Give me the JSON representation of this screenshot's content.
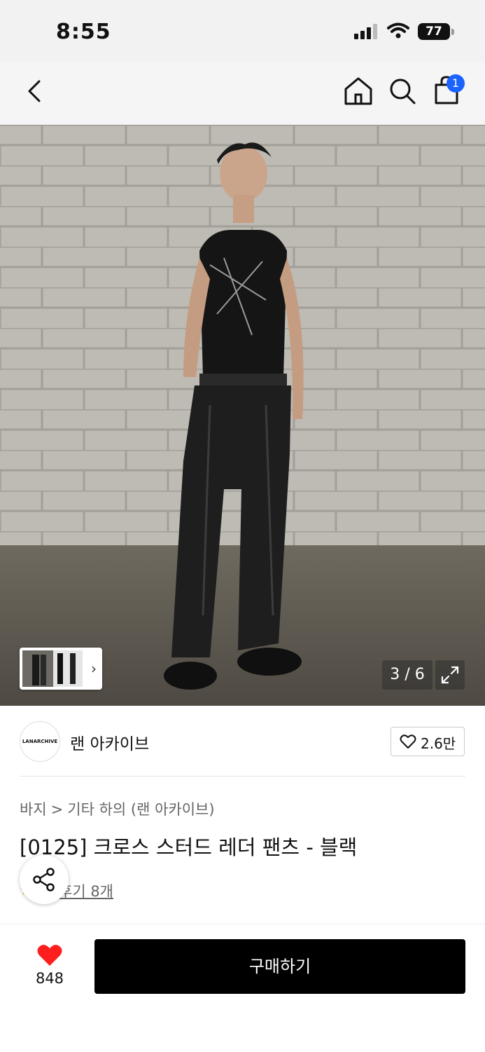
{
  "status_bar": {
    "time": "8:55",
    "battery": "77"
  },
  "nav": {
    "cart_count": "1"
  },
  "gallery": {
    "counter": "3 / 6"
  },
  "brand": {
    "logo_text": "LANARCHIVE",
    "name": "랜 아카이브",
    "likes": "2.6만"
  },
  "breadcrumb": {
    "category": "바지",
    "separator": ">",
    "subcategory": "기타 하의 (랜 아카이브)"
  },
  "product": {
    "title": "[0125] 크로스 스터드 레더 팬츠 - 블랙",
    "review_link": "후기 8개"
  },
  "bottom_bar": {
    "like_count": "848",
    "buy_label": "구매하기"
  },
  "colors": {
    "badge": "#1b63ff",
    "heart": "#ff1e1e",
    "buy_button": "#000000"
  }
}
